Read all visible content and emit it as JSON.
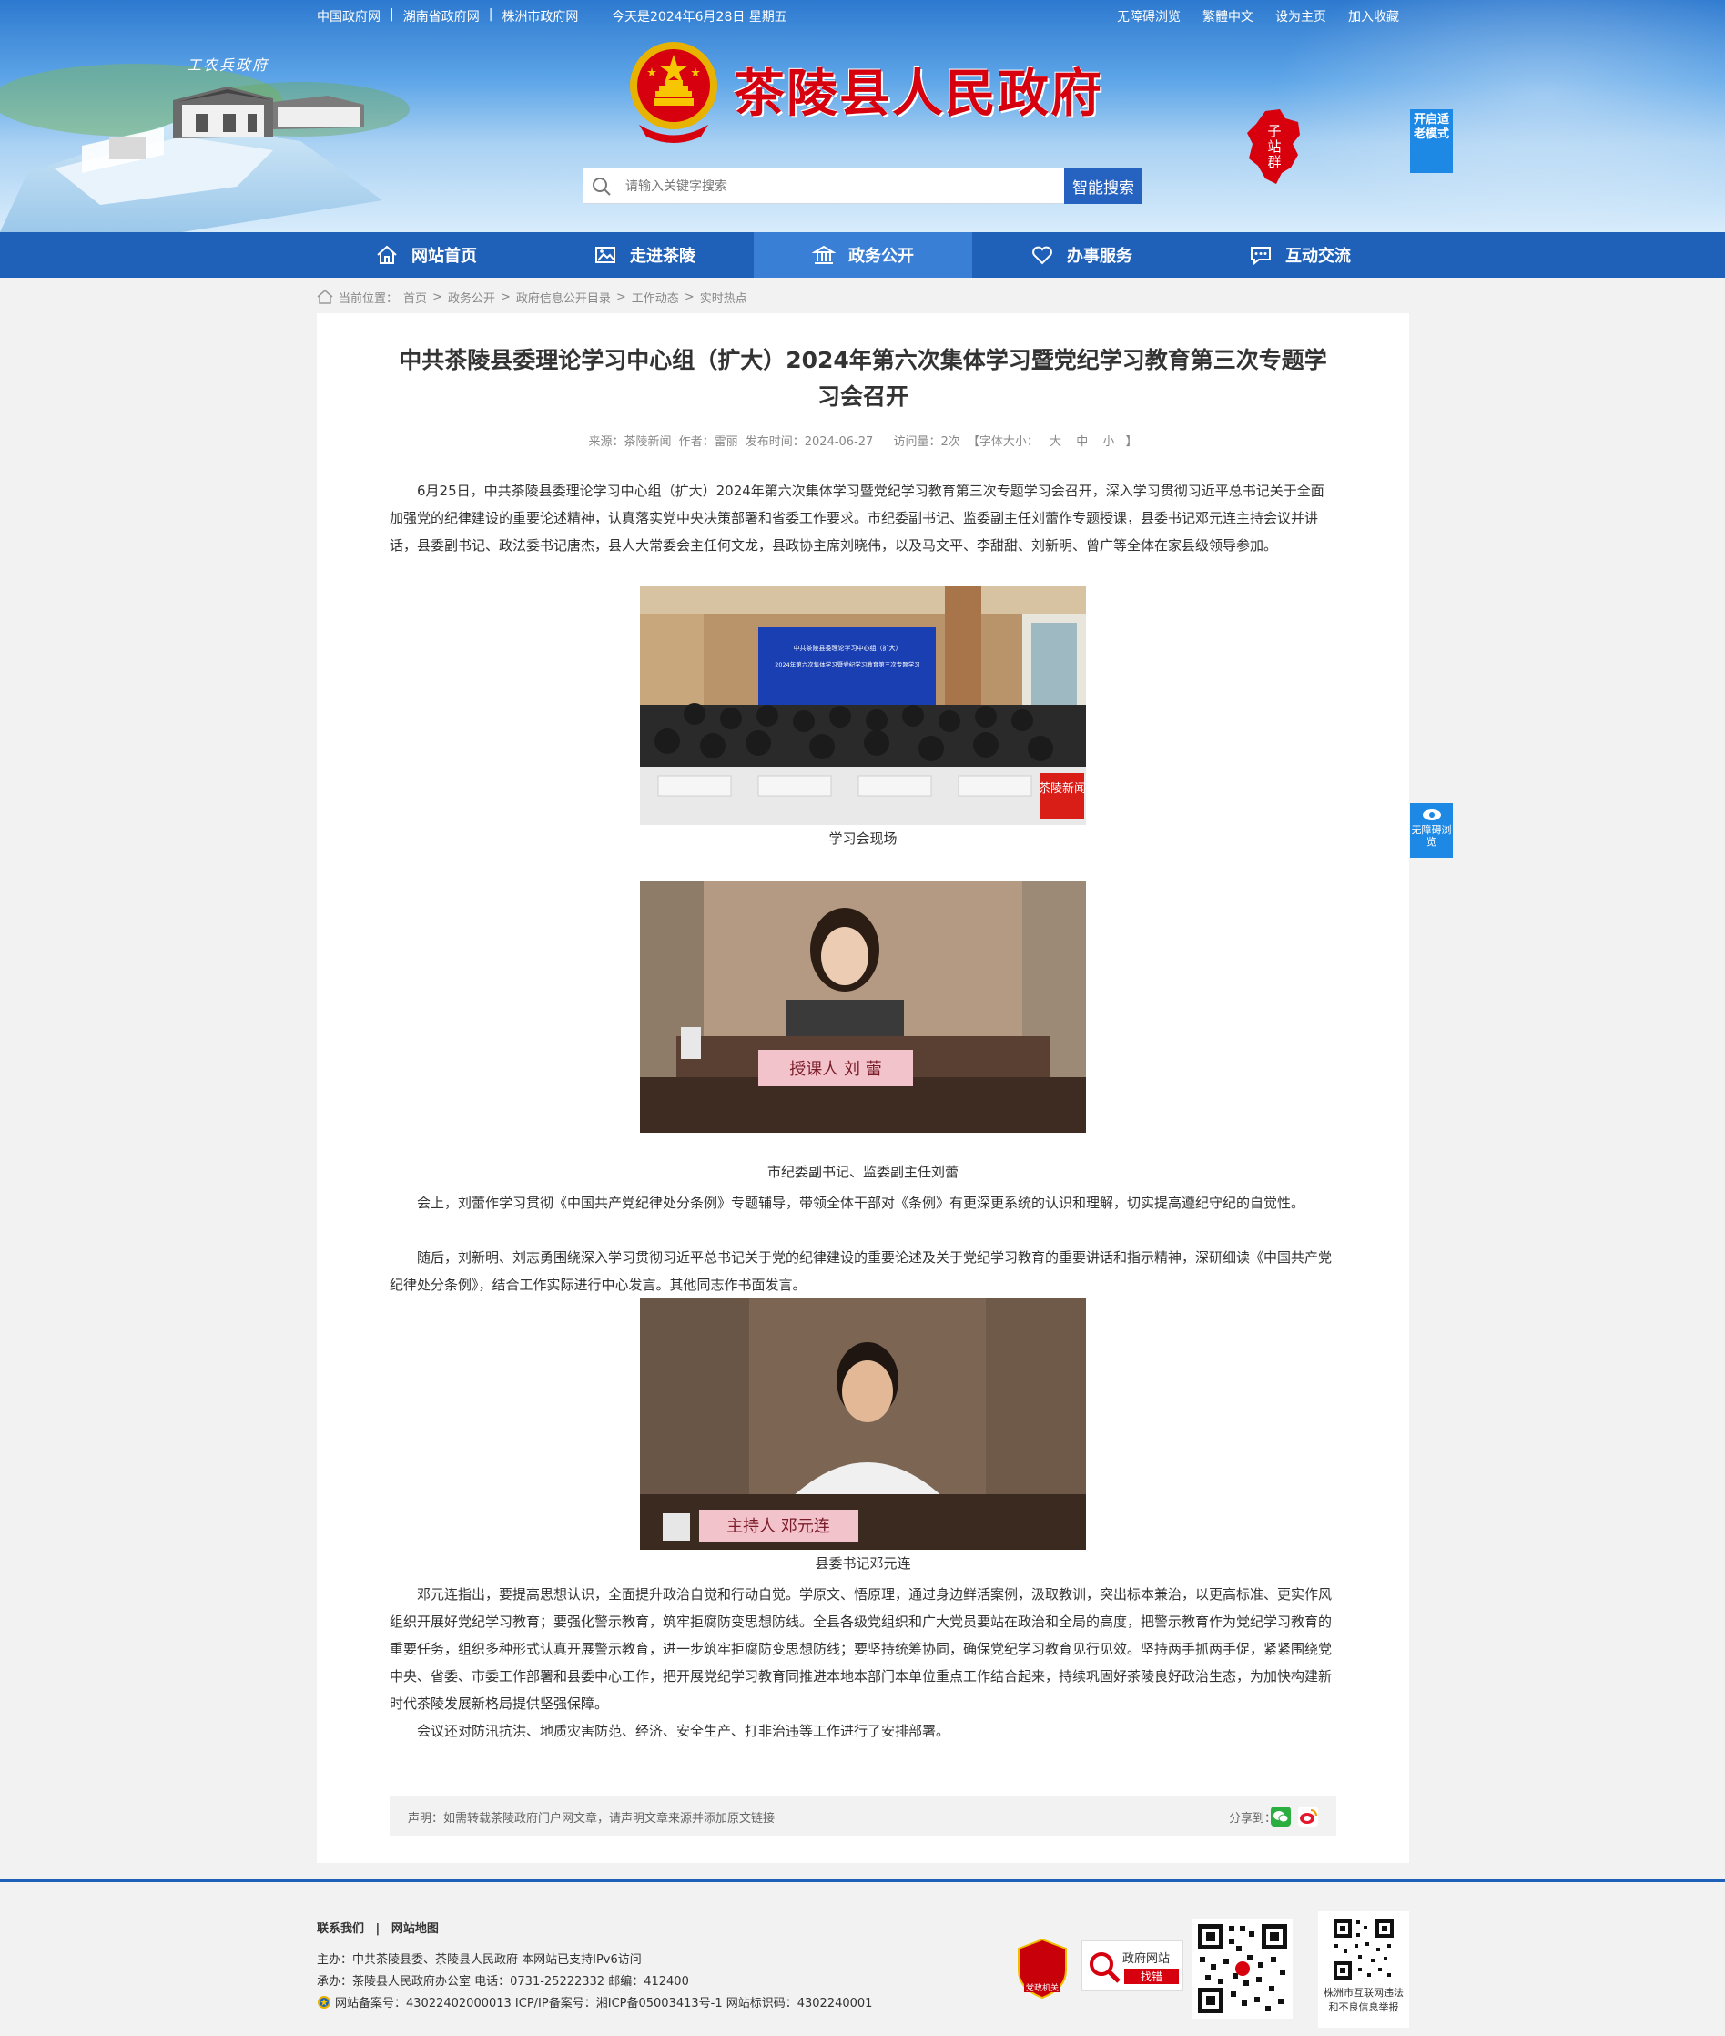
{
  "topbar": {
    "links": [
      "中国政府网",
      "湖南省政府网",
      "株洲市政府网"
    ],
    "date": "今天是2024年6月28日 星期五",
    "right_links": [
      "无障碍浏览",
      "繁體中文",
      "设为主页",
      "加入收藏"
    ]
  },
  "header": {
    "scene_caption": "工农兵政府",
    "site_title": "茶陵县人民政府",
    "substation_label": "子站群",
    "elder_mode": "开启适老模式",
    "search_placeholder": "请输入关键字搜索",
    "search_button": "智能搜索"
  },
  "nav": {
    "items": [
      {
        "label": "网站首页",
        "icon": "home-icon"
      },
      {
        "label": "走进茶陵",
        "icon": "picture-icon"
      },
      {
        "label": "政务公开",
        "icon": "government-icon"
      },
      {
        "label": "办事服务",
        "icon": "heart-icon"
      },
      {
        "label": "互动交流",
        "icon": "chat-icon"
      }
    ],
    "active": "政务公开"
  },
  "breadcrumb": {
    "prefix": "当前位置：",
    "items": [
      "首页",
      "政务公开",
      "政府信息公开目录",
      "工作动态",
      "实时热点"
    ]
  },
  "article": {
    "title": "中共茶陵县委理论学习中心组（扩大）2024年第六次集体学习暨党纪学习教育第三次专题学习会召开",
    "meta": {
      "source": "来源：茶陵新闻",
      "author": "作者：雷丽",
      "date": "发布时间：2024-06-27",
      "views": "访问量：2次",
      "font_size_label": "【字体大小：",
      "font_large": "大",
      "font_medium": "中",
      "font_small": "小",
      "font_close": "】"
    },
    "p1": "6月25日，中共茶陵县委理论学习中心组（扩大）2024年第六次集体学习暨党纪学习教育第三次专题学习会召开，深入学习贯彻习近平总书记关于全面加强党的纪律建设的重要论述精神，认真落实党中央决策部署和省委工作要求。市纪委副书记、监委副主任刘蕾作专题授课，县委书记邓元连主持会议并讲话，县委副书记、政法委书记唐杰，县人大常委会主任何文龙，县政协主席刘晓伟，以及马文平、李甜甜、刘新明、曾广等全体在家县级领导参加。",
    "photo1": {
      "banner_line1": "中共茶陵县委理论学习中心组（扩大）",
      "banner_line2": "2024年第六次集体学习暨党纪学习教育第三次专题学习",
      "watermark": "茶陵新闻",
      "caption": "学习会现场"
    },
    "photo2": {
      "nameplate": "授课人 刘 蕾",
      "caption": "市纪委副书记、监委副主任刘蕾"
    },
    "p2": "会上，刘蕾作学习贯彻《中国共产党纪律处分条例》专题辅导，带领全体干部对《条例》有更深更系统的认识和理解，切实提高遵纪守纪的自觉性。",
    "p3": "随后，刘新明、刘志勇围绕深入学习贯彻习近平总书记关于党的纪律建设的重要论述及关于党纪学习教育的重要讲话和指示精神，深研细读《中国共产党纪律处分条例》，结合工作实际进行中心发言。其他同志作书面发言。",
    "photo3": {
      "nameplate": "主持人 邓元连",
      "caption": "县委书记邓元连"
    },
    "p4": "邓元连指出，要提高思想认识，全面提升政治自觉和行动自觉。学原文、悟原理，通过身边鲜活案例，汲取教训，突出标本兼治，以更高标准、更实作风组织开展好党纪学习教育；要强化警示教育，筑牢拒腐防变思想防线。全县各级党组织和广大党员要站在政治和全局的高度，把警示教育作为党纪学习教育的重要任务，组织多种形式认真开展警示教育，进一步筑牢拒腐防变思想防线；要坚持统筹协同，确保党纪学习教育见行见效。坚持两手抓两手促，紧紧围绕党中央、省委、市委工作部署和县委中心工作，把开展党纪学习教育同推进本地本部门本单位重点工作结合起来，持续巩固好茶陵良好政治生态，为加快构建新时代茶陵发展新格局提供坚强保障。",
    "p5": "会议还对防汛抗洪、地质灾害防范、经济、安全生产、打非治违等工作进行了安排部署。",
    "notice": "声明：如需转载茶陵政府门户网文章，请声明文章来源并添加原文链接",
    "share_label": "分享到："
  },
  "side": {
    "accessible": "无障碍浏览"
  },
  "footer": {
    "links": [
      "联系我们",
      "网站地图"
    ],
    "host": "主办：中共茶陵县委、茶陵县人民政府 本网站已支持IPv6访问",
    "organizer": "承办：茶陵县人民政府办公室 电话：0731-25222332 邮编：412400",
    "record": "网站备案号：43022402000013 ICP/IP备案号：湘ICP备05003413号-1 网站标识码：4302240001",
    "badge1": "党政机关",
    "badge2_line1": "政府网站",
    "badge2_line2": "找错",
    "qr_label_line1": "株洲市互联网违法",
    "qr_label_line2": "和不良信息举报"
  },
  "colors": {
    "nav_blue": "#1f60b9",
    "title_red": "#d6000f",
    "search_button": "#2663c1",
    "side_blue": "#1e88e5"
  }
}
